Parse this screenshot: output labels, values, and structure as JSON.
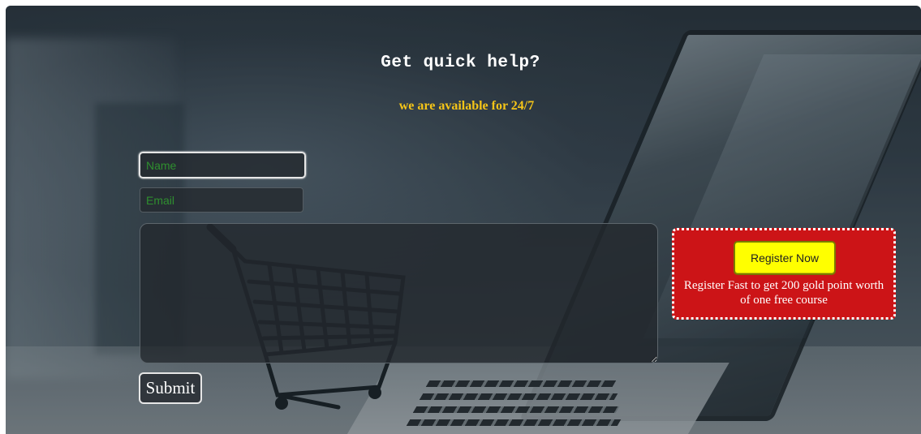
{
  "header": {
    "title": "Get quick help?",
    "subtitle": "we are available for 24/7"
  },
  "form": {
    "name_placeholder": "Name",
    "email_placeholder": "Email",
    "message_placeholder": "",
    "submit_label": "Submit"
  },
  "promo": {
    "button_label": "Register Now",
    "text": "Register Fast to get 200 gold point worth of one free course"
  },
  "colors": {
    "subtitle": "#f5c518",
    "promo_background": "#cc1417",
    "register_button": "#ffff00",
    "placeholder_text": "#2f8f2f"
  }
}
